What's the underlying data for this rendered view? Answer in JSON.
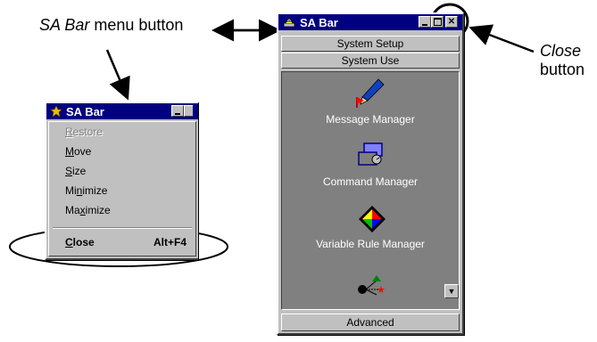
{
  "callouts": {
    "menu_button_italic": "SA Bar",
    "menu_button_rest": " menu button",
    "close_italic": "Close",
    "close_rest": "button"
  },
  "main_window": {
    "title": "SA Bar",
    "tabs": [
      "System Setup",
      "System Use"
    ],
    "items": [
      {
        "label": "Message Manager",
        "icon": "message-manager-icon"
      },
      {
        "label": "Command Manager",
        "icon": "command-manager-icon"
      },
      {
        "label": "Variable Rule Manager",
        "icon": "variable-rule-manager-icon"
      },
      {
        "label": "",
        "icon": "network-icon"
      }
    ],
    "footer_tab": "Advanced",
    "scroll_glyph": "▼"
  },
  "menu_window": {
    "title": "SA Bar",
    "items": [
      {
        "pre": "",
        "u": "R",
        "post": "estore",
        "shortcut": "",
        "disabled": true
      },
      {
        "pre": "",
        "u": "M",
        "post": "ove",
        "shortcut": "",
        "disabled": false
      },
      {
        "pre": "",
        "u": "S",
        "post": "ize",
        "shortcut": "",
        "disabled": false
      },
      {
        "pre": "Mi",
        "u": "n",
        "post": "imize",
        "shortcut": "",
        "disabled": false
      },
      {
        "pre": "Ma",
        "u": "x",
        "post": "imize",
        "shortcut": "",
        "disabled": false
      }
    ],
    "close": {
      "pre": "",
      "u": "C",
      "post": "lose",
      "shortcut": "Alt+F4"
    }
  }
}
